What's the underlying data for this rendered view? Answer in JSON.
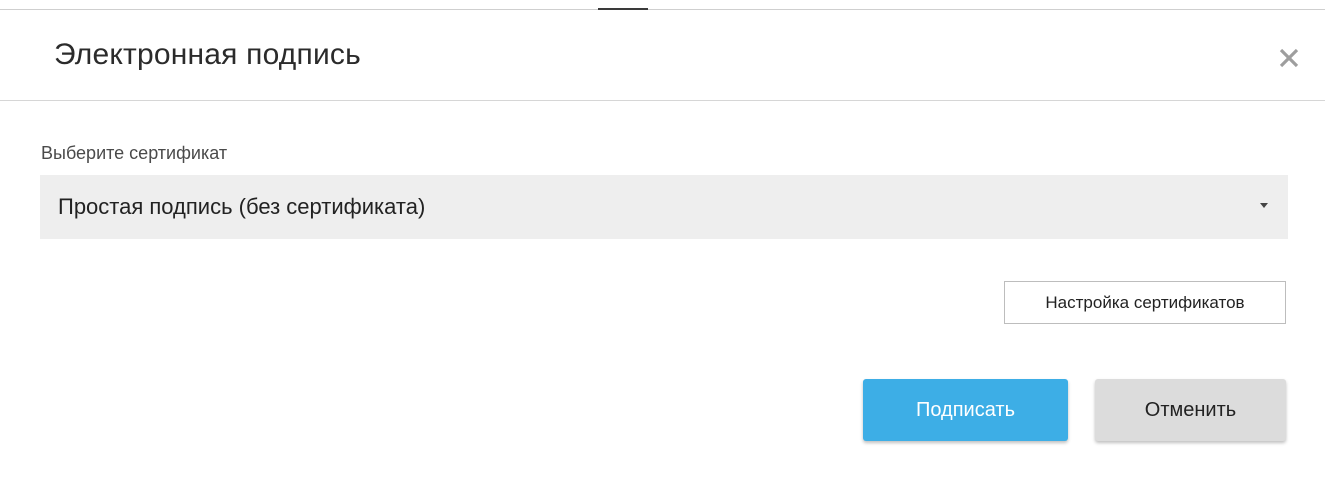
{
  "dialog": {
    "title": "Электронная подпись",
    "close_icon": "close-icon"
  },
  "certificate": {
    "label": "Выберите сертификат",
    "selected_value": "Простая подпись (без сертификата)",
    "caret_icon": "caret-down-icon"
  },
  "buttons": {
    "settings_label": "Настройка сертификатов",
    "sign_label": "Подписать",
    "cancel_label": "Отменить"
  },
  "colors": {
    "primary": "#3daee6",
    "secondary": "#dcdcdc",
    "select_bg": "#eeeeee"
  }
}
